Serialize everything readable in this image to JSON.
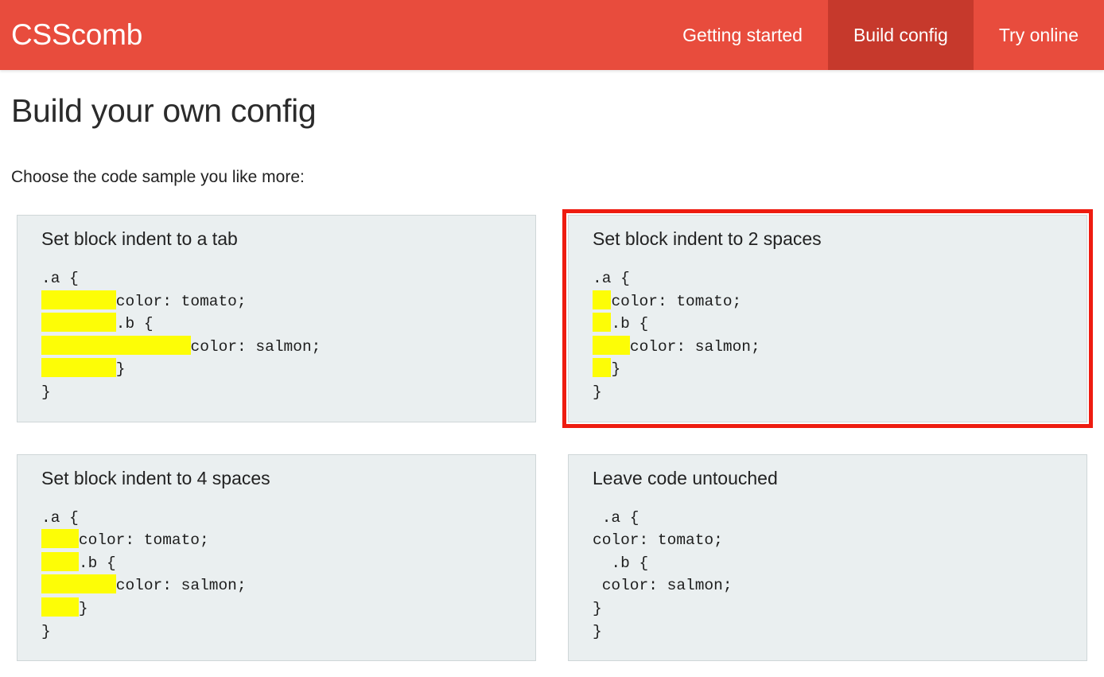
{
  "header": {
    "brand": "CSScomb",
    "nav": [
      {
        "label": "Getting started",
        "active": false
      },
      {
        "label": "Build config",
        "active": true
      },
      {
        "label": "Try online",
        "active": false
      }
    ],
    "colors": {
      "bar": "#e84c3d",
      "active_tab": "#c6392b",
      "brand_text": "#ffffff"
    }
  },
  "main": {
    "title": "Build your own config",
    "intro": "Choose the code sample you like more:",
    "selection_color": "#ee1c10",
    "whitespace_color": "#fdfd06",
    "card_background": "#eaeff0",
    "samples": [
      {
        "id": "block-indent-tab",
        "heading": "Set block indent to a tab",
        "selected": false,
        "lines": [
          {
            "indent_chars": 0,
            "text": ".a {"
          },
          {
            "indent_chars": 8,
            "text": "color: tomato;"
          },
          {
            "indent_chars": 8,
            "text": ".b {"
          },
          {
            "indent_chars": 16,
            "text": "color: salmon;"
          },
          {
            "indent_chars": 8,
            "text": "}"
          },
          {
            "indent_chars": 0,
            "text": "}"
          }
        ]
      },
      {
        "id": "block-indent-2-spaces",
        "heading": "Set block indent to 2 spaces",
        "selected": true,
        "lines": [
          {
            "indent_chars": 0,
            "text": ".a {"
          },
          {
            "indent_chars": 2,
            "text": "color: tomato;"
          },
          {
            "indent_chars": 2,
            "text": ".b {"
          },
          {
            "indent_chars": 4,
            "text": "color: salmon;"
          },
          {
            "indent_chars": 2,
            "text": "}"
          },
          {
            "indent_chars": 0,
            "text": "}"
          }
        ]
      },
      {
        "id": "block-indent-4-spaces",
        "heading": "Set block indent to 4 spaces",
        "selected": false,
        "lines": [
          {
            "indent_chars": 0,
            "text": ".a {"
          },
          {
            "indent_chars": 4,
            "text": "color: tomato;"
          },
          {
            "indent_chars": 4,
            "text": ".b {"
          },
          {
            "indent_chars": 8,
            "text": "color: salmon;"
          },
          {
            "indent_chars": 4,
            "text": "}"
          },
          {
            "indent_chars": 0,
            "text": "}"
          }
        ]
      },
      {
        "id": "leave-code-untouched",
        "heading": "Leave code untouched",
        "selected": false,
        "lines": [
          {
            "indent_chars": 0,
            "plain_indent": 1,
            "text": ".a {"
          },
          {
            "indent_chars": 0,
            "plain_indent": 0,
            "text": "color: tomato;"
          },
          {
            "indent_chars": 0,
            "plain_indent": 2,
            "text": ".b {"
          },
          {
            "indent_chars": 0,
            "plain_indent": 1,
            "text": "color: salmon;"
          },
          {
            "indent_chars": 0,
            "plain_indent": 0,
            "text": "}"
          },
          {
            "indent_chars": 0,
            "plain_indent": 0,
            "text": "}"
          }
        ]
      }
    ]
  }
}
